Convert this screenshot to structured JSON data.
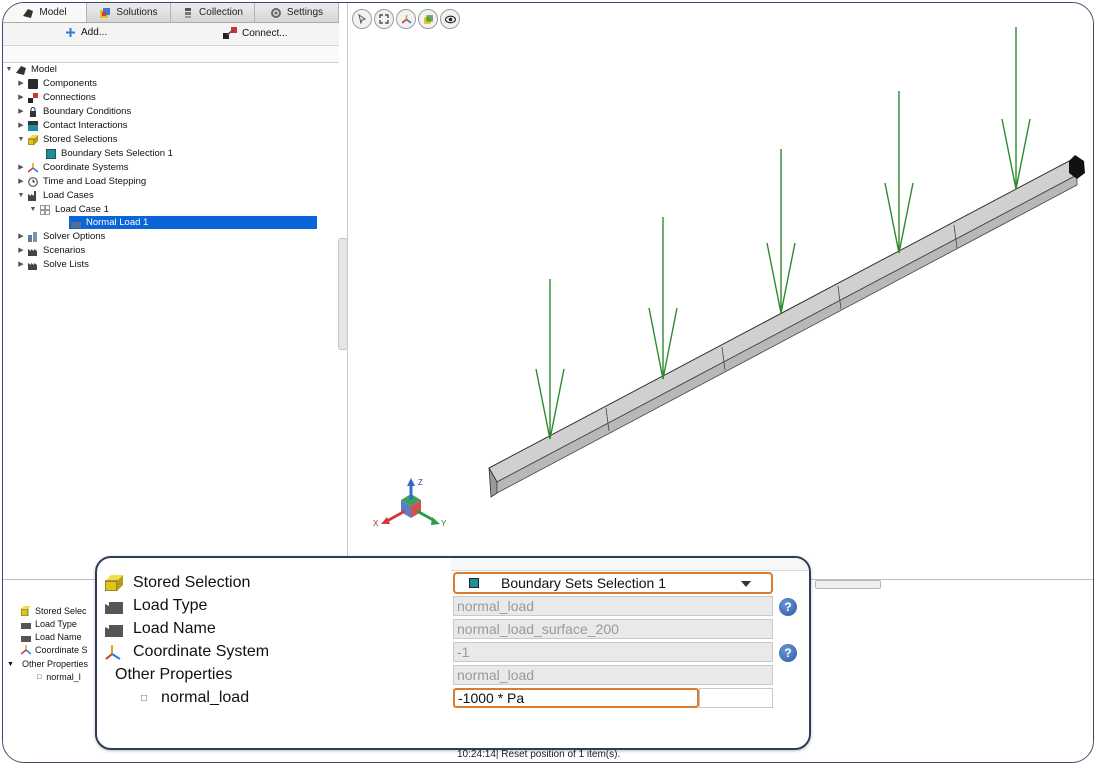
{
  "tabs": [
    {
      "label": "Model",
      "icon": "model-icon"
    },
    {
      "label": "Solutions",
      "icon": "solutions-icon"
    },
    {
      "label": "Collection",
      "icon": "collection-icon"
    },
    {
      "label": "Settings",
      "icon": "settings-icon"
    }
  ],
  "toolbar": {
    "add_label": "Add...",
    "connect_label": "Connect..."
  },
  "tree": {
    "model": "Model",
    "components": "Components",
    "connections": "Connections",
    "boundary_conditions": "Boundary Conditions",
    "contact_interactions": "Contact Interactions",
    "stored_selections": "Stored Selections",
    "boundary_sets_selection": "Boundary Sets Selection 1",
    "coordinate_systems": "Coordinate Systems",
    "time_load_stepping": "Time and Load Stepping",
    "load_cases": "Load Cases",
    "load_case_1": "Load Case 1",
    "normal_load_1": "Normal Load 1",
    "solver_options": "Solver Options",
    "scenarios": "Scenarios",
    "solve_lists": "Solve Lists"
  },
  "axes": {
    "x": "X",
    "y": "Y",
    "z": "Z"
  },
  "bottom_tree": {
    "stored_selection": "Stored Selec",
    "load_type": "Load Type",
    "load_name": "Load Name",
    "coordinate_system": "Coordinate S",
    "other_properties": "Other Properties",
    "normal_load": "normal_l"
  },
  "log": {
    "line": "10:24:14| Reset position of 1 item(s)."
  },
  "properties": {
    "stored_selection": {
      "label": "Stored Selection",
      "value": "Boundary Sets Selection 1"
    },
    "load_type": {
      "label": "Load Type",
      "value": "normal_load"
    },
    "load_name": {
      "label": "Load Name",
      "value": "normal_load_surface_200"
    },
    "coordinate_system": {
      "label": "Coordinate System",
      "value": "-1"
    },
    "other_properties": {
      "label": "Other Properties",
      "value": "normal_load"
    },
    "normal_load": {
      "label": "normal_load",
      "value": "-1000 * Pa"
    }
  },
  "help_glyph": "?",
  "colors": {
    "selection": "#0a66d6",
    "highlight_border": "#e07a2a",
    "load_arrow": "#2f8a2f",
    "beam": "#c8c8c8"
  }
}
